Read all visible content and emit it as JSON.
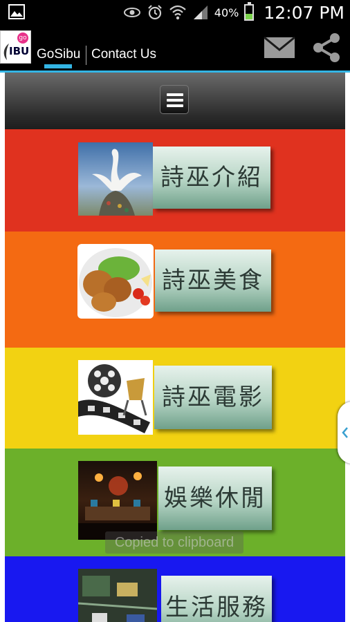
{
  "status_bar": {
    "battery_text": "40%",
    "battery_level": 0.4,
    "time": "12:07 PM",
    "icons": [
      "gallery-icon",
      "eye-icon",
      "alarm-icon",
      "wifi-icon",
      "signal-icon",
      "battery-icon"
    ]
  },
  "app_bar": {
    "logo_go": "go",
    "logo_text": "IBU",
    "tabs": [
      {
        "label": "GoSibu",
        "active": true
      },
      {
        "label": "Contact Us",
        "active": false
      }
    ],
    "actions": [
      "mail-icon",
      "share-icon"
    ],
    "accent": "#33b5e5"
  },
  "menu": {
    "icon": "hamburger-icon"
  },
  "categories": [
    {
      "label": "詩巫介紹",
      "color": "#e0321f",
      "image": "swan-statue"
    },
    {
      "label": "詩巫美食",
      "color": "#f46a12",
      "image": "fried-chicken"
    },
    {
      "label": "詩巫電影",
      "color": "#f2d212",
      "image": "film-reel"
    },
    {
      "label": "娛樂休閒",
      "color": "#6cb02a",
      "image": "night-bar"
    },
    {
      "label": "生活服務",
      "color": "#1818f0",
      "image": "circuit-board"
    }
  ],
  "toast": {
    "text": "Copied to clipboard"
  }
}
